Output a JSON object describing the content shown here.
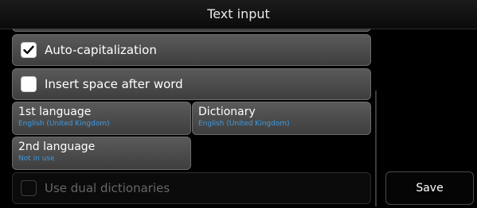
{
  "window": {
    "title": "Text input"
  },
  "options": {
    "auto_capitalization": {
      "label": "Auto-capitalization",
      "checked": true
    },
    "insert_space": {
      "label": "Insert space after word",
      "checked": false
    },
    "dual_dictionaries": {
      "label": "Use dual dictionaries",
      "checked": false,
      "enabled": false
    }
  },
  "pickers": {
    "first_language": {
      "label": "1st language",
      "value": "English (United Kingdom)"
    },
    "dictionary": {
      "label": "Dictionary",
      "value": "English (United Kingdom)"
    },
    "second_language": {
      "label": "2nd language",
      "value": "Not in use"
    }
  },
  "buttons": {
    "save": "Save"
  },
  "colors": {
    "accent_blue": "#3c9be4",
    "item_bg": "#4a4a4a",
    "background": "#000000"
  }
}
